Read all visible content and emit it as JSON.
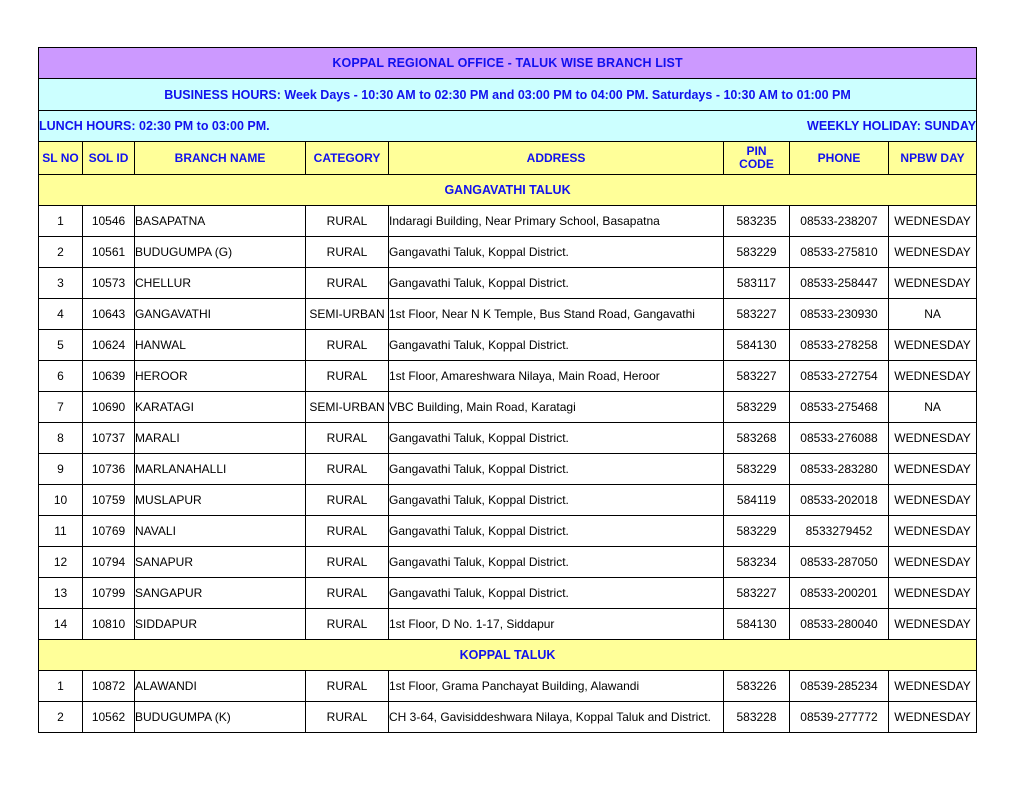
{
  "header": {
    "title": "KOPPAL REGIONAL OFFICE - TALUK WISE BRANCH LIST",
    "business_hours": "BUSINESS HOURS: Week Days - 10:30 AM to 02:30 PM and 03:00 PM to 04:00 PM. Saturdays - 10:30 AM to 01:00 PM",
    "lunch_hours": "LUNCH HOURS: 02:30 PM to 03:00 PM.",
    "weekly_holiday": "WEEKLY HOLIDAY: SUNDAY"
  },
  "colors": {
    "title_bg": "#cc99ff",
    "hours_bg": "#ccffff",
    "header_bg": "#ffff99",
    "text_blue": "#1111ee",
    "cell_bg": "#ffffff",
    "border": "#000000"
  },
  "columns": [
    "SL NO",
    "SOL ID",
    "BRANCH NAME",
    "CATEGORY",
    "ADDRESS",
    "PIN CODE",
    "PHONE",
    "NPBW DAY"
  ],
  "column_pin_code_line1": "PIN",
  "column_pin_code_line2": "CODE",
  "sections": [
    {
      "name": "GANGAVATHI TALUK",
      "rows": [
        {
          "sl": "1",
          "sol": "10546",
          "branch": "BASAPATNA",
          "category": "RURAL",
          "address": "Indaragi Building, Near Primary School, Basapatna",
          "pin": "583235",
          "phone": "08533-238207",
          "npbw": "WEDNESDAY"
        },
        {
          "sl": "2",
          "sol": "10561",
          "branch": "BUDUGUMPA (G)",
          "category": "RURAL",
          "address": "Gangavathi Taluk, Koppal District.",
          "pin": "583229",
          "phone": "08533-275810",
          "npbw": "WEDNESDAY"
        },
        {
          "sl": "3",
          "sol": "10573",
          "branch": "CHELLUR",
          "category": "RURAL",
          "address": "Gangavathi Taluk, Koppal District.",
          "pin": "583117",
          "phone": "08533-258447",
          "npbw": "WEDNESDAY"
        },
        {
          "sl": "4",
          "sol": "10643",
          "branch": "GANGAVATHI",
          "category": "SEMI-URBAN",
          "address": "1st Floor, Near N K Temple, Bus Stand Road, Gangavathi",
          "pin": "583227",
          "phone": "08533-230930",
          "npbw": "NA"
        },
        {
          "sl": "5",
          "sol": "10624",
          "branch": "HANWAL",
          "category": "RURAL",
          "address": "Gangavathi Taluk, Koppal District.",
          "pin": "584130",
          "phone": "08533-278258",
          "npbw": "WEDNESDAY"
        },
        {
          "sl": "6",
          "sol": "10639",
          "branch": "HEROOR",
          "category": "RURAL",
          "address": "1st Floor, Amareshwara Nilaya, Main Road, Heroor",
          "pin": "583227",
          "phone": "08533-272754",
          "npbw": "WEDNESDAY"
        },
        {
          "sl": "7",
          "sol": "10690",
          "branch": "KARATAGI",
          "category": "SEMI-URBAN",
          "address": "VBC Building, Main Road, Karatagi",
          "pin": "583229",
          "phone": "08533-275468",
          "npbw": "NA"
        },
        {
          "sl": "8",
          "sol": "10737",
          "branch": "MARALI",
          "category": "RURAL",
          "address": "Gangavathi Taluk, Koppal District.",
          "pin": "583268",
          "phone": "08533-276088",
          "npbw": "WEDNESDAY"
        },
        {
          "sl": "9",
          "sol": "10736",
          "branch": "MARLANAHALLI",
          "category": "RURAL",
          "address": "Gangavathi Taluk, Koppal District.",
          "pin": "583229",
          "phone": "08533-283280",
          "npbw": "WEDNESDAY"
        },
        {
          "sl": "10",
          "sol": "10759",
          "branch": "MUSLAPUR",
          "category": "RURAL",
          "address": "Gangavathi Taluk, Koppal District.",
          "pin": "584119",
          "phone": "08533-202018",
          "npbw": "WEDNESDAY"
        },
        {
          "sl": "11",
          "sol": "10769",
          "branch": "NAVALI",
          "category": "RURAL",
          "address": "Gangavathi Taluk, Koppal District.",
          "pin": "583229",
          "phone": "8533279452",
          "npbw": "WEDNESDAY"
        },
        {
          "sl": "12",
          "sol": "10794",
          "branch": "SANAPUR",
          "category": "RURAL",
          "address": "Gangavathi Taluk, Koppal District.",
          "pin": "583234",
          "phone": "08533-287050",
          "npbw": "WEDNESDAY"
        },
        {
          "sl": "13",
          "sol": "10799",
          "branch": "SANGAPUR",
          "category": "RURAL",
          "address": "Gangavathi Taluk, Koppal District.",
          "pin": "583227",
          "phone": "08533-200201",
          "npbw": "WEDNESDAY"
        },
        {
          "sl": "14",
          "sol": "10810",
          "branch": "SIDDAPUR",
          "category": "RURAL",
          "address": "1st Floor, D No. 1-17, Siddapur",
          "pin": "584130",
          "phone": "08533-280040",
          "npbw": "WEDNESDAY"
        }
      ]
    },
    {
      "name": "KOPPAL TALUK",
      "rows": [
        {
          "sl": "1",
          "sol": "10872",
          "branch": "ALAWANDI",
          "category": "RURAL",
          "address": "1st Floor, Grama Panchayat Building, Alawandi",
          "pin": "583226",
          "phone": "08539-285234",
          "npbw": "WEDNESDAY"
        },
        {
          "sl": "2",
          "sol": "10562",
          "branch": "BUDUGUMPA (K)",
          "category": "RURAL",
          "address": "CH 3-64, Gavisiddeshwara Nilaya, Koppal Taluk and District.",
          "pin": "583228",
          "phone": "08539-277772",
          "npbw": "WEDNESDAY"
        }
      ]
    }
  ]
}
